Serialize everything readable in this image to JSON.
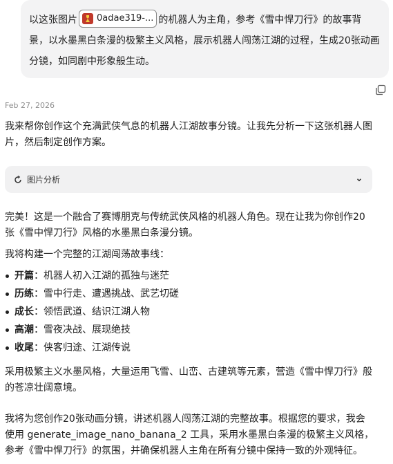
{
  "user_message": {
    "line1_before": "以这张图片",
    "attachment_label": "0adae319-...",
    "line1_after": "的机器人为主角，参考《雪中悍刀行》的故事背",
    "line2": "景，以水墨黑白条漫的极繁主义风格，展示机器人闯荡江湖的过程，生成20张动画",
    "line3": "分镜，如同剧中形象般生动。"
  },
  "timestamp": "Feb 27, 2026",
  "reply": {
    "intro_line1": "我来帮你创作这个充满武侠气息的机器人江湖故事分镜。让我先分析一下这张机器人图",
    "intro_line2": "片，然后制定创作方案。",
    "analysis_label": "图片分析",
    "perfect_line1": "完美！这是一个融合了赛博朋克与传统武侠风格的机器人角色。现在让我为你创作20",
    "perfect_line2": "张《雪中悍刀行》风格的水墨黑白条漫分镜。",
    "story_intro": "我将构建一个完整的江湖闯荡故事线：",
    "story_items": [
      {
        "key": "开篇",
        "sep": "：",
        "text": "机器人初入江湖的孤独与迷茫"
      },
      {
        "key": "历练",
        "sep": "：",
        "text": "雪中行走、遭遇挑战、武艺切磋"
      },
      {
        "key": "成长",
        "sep": "：",
        "text": "领悟武道、结识江湖人物"
      },
      {
        "key": "高潮",
        "sep": "：",
        "text": "雪夜决战、展现绝技"
      },
      {
        "key": "收尾",
        "sep": "：",
        "text": "侠客归途、江湖传说"
      }
    ],
    "style_line1": "采用极繁主义水墨风格，大量运用飞雪、山峦、古建筑等元素，营造《雪中悍刀行》般",
    "style_line2": "的苍凉壮阔意境。",
    "plan_line1": "我将为您创作20张动画分镜，讲述机器人闯荡江湖的完整故事。根据您的要求，我会",
    "plan_line2": "使用 generate_image_nano_banana_2 工具，采用水墨黑白条漫的极繁主义风格，",
    "plan_line3": "参考《雪中悍刀行》的氛围，并确保机器人主角在所有分镜中保持一致的外观特征。"
  }
}
